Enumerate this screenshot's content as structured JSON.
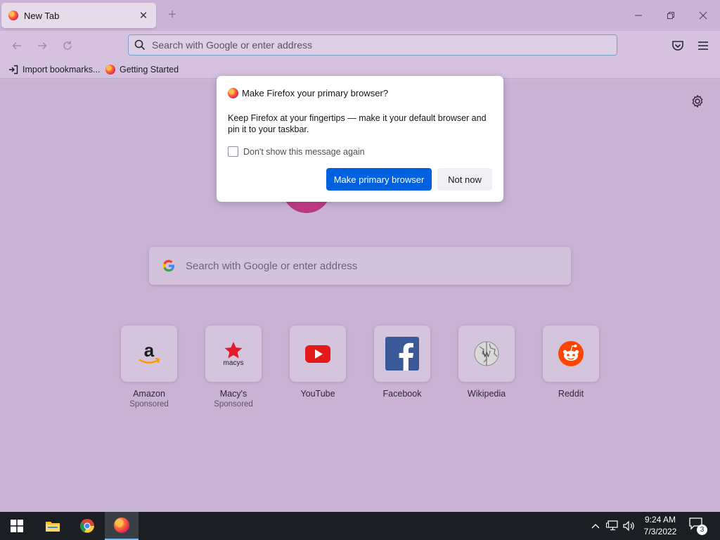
{
  "tab": {
    "title": "New Tab",
    "close_glyph": "✕"
  },
  "new_tab_glyph": "+",
  "navbar": {
    "url_placeholder": "Search with Google or enter address"
  },
  "bookmarks": [
    {
      "label": "Import bookmarks...",
      "icon": "import-icon"
    },
    {
      "label": "Getting Started",
      "icon": "firefox-icon"
    }
  ],
  "content": {
    "search_placeholder": "Search with Google or enter address",
    "top_sites": [
      {
        "name": "Amazon",
        "sub": "Sponsored",
        "icon": "amazon-logo"
      },
      {
        "name": "Macy's",
        "sub": "Sponsored",
        "icon": "macys-logo"
      },
      {
        "name": "YouTube",
        "sub": "",
        "icon": "youtube-logo"
      },
      {
        "name": "Facebook",
        "sub": "",
        "icon": "facebook-logo"
      },
      {
        "name": "Wikipedia",
        "sub": "",
        "icon": "wikipedia-logo"
      },
      {
        "name": "Reddit",
        "sub": "",
        "icon": "reddit-logo"
      }
    ]
  },
  "dialog": {
    "title": "Make Firefox your primary browser?",
    "body": "Keep Firefox at your fingertips — make it your default browser and pin it to your taskbar.",
    "checkbox_label": "Don't show this message again",
    "checkbox_checked": false,
    "primary_button": "Make primary browser",
    "secondary_button": "Not now"
  },
  "taskbar": {
    "time": "9:24 AM",
    "date": "7/3/2022",
    "notification_count": "3"
  },
  "colors": {
    "accent_button": "#0061e0",
    "taskbar": "#1b1f24",
    "page_tint": "#c9b3d5"
  }
}
